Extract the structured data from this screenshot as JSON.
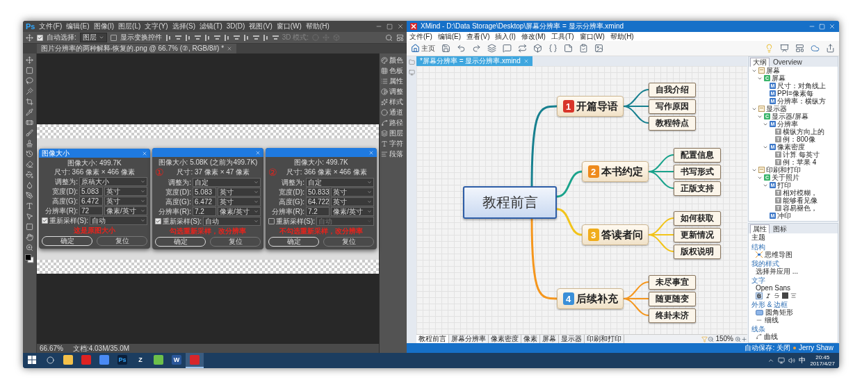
{
  "photoshop": {
    "logo": "Ps",
    "menu": [
      "文件(F)",
      "编辑(E)",
      "图像(I)",
      "图层(L)",
      "文字(Y)",
      "选择(S)",
      "滤镜(T)",
      "3D(D)",
      "视图(V)",
      "窗口(W)",
      "帮助(H)"
    ],
    "options": {
      "auto_select": {
        "label": "自动选择:",
        "checked": true
      },
      "target": "图层",
      "show_transform": {
        "label": "显示变换控件",
        "checked": false
      },
      "mode_3d": "3D 模式:"
    },
    "document_tab": "图片分辨率的两种解释-恢复的.png @ 66.7% (②, RGB/8#) *",
    "dialogs": [
      {
        "title": "图像大小",
        "image_size": "图像大小: 499.7K",
        "dimensions": "尺寸: 366 像素 × 466 像素",
        "fit": {
          "label": "调整为:",
          "value": "原稿大小"
        },
        "rows": [
          {
            "label": "宽度(D):",
            "value": "5.083",
            "unit": "英寸"
          },
          {
            "label": "高度(G):",
            "value": "6.472",
            "unit": "英寸"
          },
          {
            "label": "分辨率(R):",
            "value": "72",
            "unit": "像素/英寸"
          }
        ],
        "resample": {
          "label": "重新采样(S):",
          "checked": true,
          "value": "自动"
        },
        "caption": "这是原图大小",
        "buttons": [
          "确定",
          "复位"
        ]
      },
      {
        "marker": "①",
        "image_size": "图像大小: 5.08K (之前为499.7K)",
        "dimensions": "尺寸: 37 像素 × 47 像素",
        "fit": {
          "label": "调整为:",
          "value": "自定"
        },
        "rows": [
          {
            "label": "宽度(D):",
            "value": "5.083",
            "unit": "英寸"
          },
          {
            "label": "高度(G):",
            "value": "6.472",
            "unit": "英寸"
          },
          {
            "label": "分辨率(R):",
            "value": "7.2",
            "unit": "像素/英寸"
          }
        ],
        "resample": {
          "label": "重新采样(S):",
          "checked": true,
          "value": "自动"
        },
        "caption": "勾选重新采样，改分辨率",
        "buttons": [
          "确定",
          "复位"
        ]
      },
      {
        "marker": "②",
        "image_size": "图像大小: 499.7K",
        "dimensions": "尺寸: 366 像素 × 466 像素",
        "fit": {
          "label": "调整为:",
          "value": "自定"
        },
        "rows": [
          {
            "label": "宽度(D):",
            "value": "50.833",
            "unit": "英寸"
          },
          {
            "label": "高度(G):",
            "value": "64.722",
            "unit": "英寸"
          },
          {
            "label": "分辨率(R):",
            "value": "7.2",
            "unit": "像素/英寸"
          }
        ],
        "resample": {
          "label": "重新采样(S):",
          "checked": false,
          "value": "自动"
        },
        "caption": "不勾选重新采样，改分辨率",
        "buttons": [
          "确定",
          "复位"
        ]
      }
    ],
    "panels": [
      "颜色",
      "色板",
      "属性",
      "调整",
      "样式",
      "通道",
      "路径",
      "图层",
      "字符",
      "段落"
    ],
    "status": {
      "zoom": "66.67%",
      "doc": "文档:4.03M/35.0M"
    }
  },
  "xmind": {
    "title": "XMind - D:\\Data Storage\\Desktop\\屏幕分辨率 = 显示分辨率.xmind",
    "menu": [
      "文件(F)",
      "编辑(E)",
      "查看(V)",
      "插入(I)",
      "修改(M)",
      "工具(T)",
      "窗口(W)",
      "帮助(H)"
    ],
    "home_label": "主页",
    "file_tab": "*屏幕分辨率 = 显示分辨率.xmind",
    "map": {
      "central": "教程前言",
      "topics": [
        {
          "badge": "1",
          "label": "开篇导语",
          "color": "#d8352a",
          "branch": {
            "color": "#17808f"
          },
          "children": [
            "自我介绍",
            "写作原因",
            "教程特点"
          ]
        },
        {
          "badge": "2",
          "label": "本书约定",
          "color": "#ee8a1c",
          "branch": {
            "color": "#1aa38c"
          },
          "children": [
            "配置信息",
            "书写形式",
            "正版支持"
          ]
        },
        {
          "badge": "3",
          "label": "答读者问",
          "color": "#f0ad1c",
          "branch": {
            "color": "#f2c41a"
          },
          "children": [
            "如何获取",
            "更新情况",
            "版权说明"
          ]
        },
        {
          "badge": "4",
          "label": "后续补充",
          "color": "#3a8fd8",
          "branch": {
            "color": "#f5961c"
          },
          "children": [
            "未尽事宜",
            "随更随变",
            "终卦未济"
          ]
        }
      ]
    },
    "sheets": [
      {
        "label": "教程前言",
        "selected": true
      },
      {
        "label": "屏幕分辨率",
        "selected": false
      },
      {
        "label": "像素密度",
        "selected": false
      },
      {
        "label": "像素",
        "selected": false
      },
      {
        "label": "屏幕",
        "selected": false
      },
      {
        "label": "显示器",
        "selected": false
      },
      {
        "label": "印刷和打印",
        "selected": false
      }
    ],
    "zoom": "150%",
    "outline": {
      "tabs": [
        {
          "label": "大纲",
          "selected": true
        },
        {
          "label": "Overview",
          "selected": false
        }
      ],
      "tree": [
        {
          "kind": "sheet",
          "label": "屏幕",
          "expanded": true,
          "children": [
            {
              "kind": "central",
              "icon": "C",
              "label": "屏幕",
              "expanded": true,
              "children": [
                {
                  "kind": "main",
                  "icon": "M",
                  "label": "尺寸：对角线上"
                },
                {
                  "kind": "main",
                  "icon": "M",
                  "label": "PPI=像素每"
                },
                {
                  "kind": "main",
                  "icon": "M",
                  "label": "分辨率：横纵方"
                }
              ]
            }
          ]
        },
        {
          "kind": "sheet",
          "label": "显示器",
          "expanded": true,
          "children": [
            {
              "kind": "central",
              "icon": "C",
              "label": "显示器/屏幕",
              "expanded": true,
              "children": [
                {
                  "kind": "main",
                  "icon": "M",
                  "label": "分辨率",
                  "expanded": true,
                  "children": [
                    {
                      "kind": "sub",
                      "icon": "T",
                      "label": "横纵方向上的"
                    },
                    {
                      "kind": "sub",
                      "icon": "T",
                      "label": "例：800像"
                    }
                  ]
                },
                {
                  "kind": "main",
                  "icon": "M",
                  "label": "像素密度",
                  "expanded": true,
                  "children": [
                    {
                      "kind": "sub",
                      "icon": "T",
                      "label": "计算 每英寸"
                    },
                    {
                      "kind": "sub",
                      "icon": "T",
                      "label": "例：苹果 4"
                    }
                  ]
                }
              ]
            }
          ]
        },
        {
          "kind": "sheet",
          "label": "印刷和打印",
          "expanded": true,
          "children": [
            {
              "kind": "central",
              "icon": "C",
              "label": "关于照片",
              "expanded": true,
              "children": [
                {
                  "kind": "main",
                  "icon": "M",
                  "label": "打印",
                  "expanded": true,
                  "children": [
                    {
                      "kind": "sub",
                      "icon": "T",
                      "label": "相对模糊，"
                    },
                    {
                      "kind": "sub",
                      "icon": "T",
                      "label": "能够看见像"
                    },
                    {
                      "kind": "sub",
                      "icon": "T",
                      "label": "容易褪色，"
                    }
                  ]
                },
                {
                  "kind": "main",
                  "icon": "M",
                  "label": "冲印"
                }
              ]
            }
          ]
        }
      ]
    },
    "properties": {
      "tabs": [
        {
          "label": "属性",
          "selected": true
        },
        {
          "label": "图标",
          "selected": false
        }
      ],
      "heading": "主题",
      "sections": [
        {
          "kind": "structure",
          "title": "结构",
          "value": "思维导图"
        },
        {
          "kind": "style",
          "title": "我的样式",
          "value": "选择并应用 ..."
        },
        {
          "kind": "text",
          "title": "文字",
          "font": "Open Sans",
          "bold": true,
          "italic": false
        },
        {
          "kind": "shape",
          "title": "外形 & 边框",
          "shape": "圆角矩形",
          "border": "细线"
        },
        {
          "kind": "line",
          "title": "线条",
          "value": "曲线"
        }
      ]
    },
    "status": {
      "autosave": "自动保存: 关闭",
      "user": "Jerry Shaw"
    }
  },
  "taskbar": {
    "apps": [
      {
        "kind": "explorer",
        "selected": false
      },
      {
        "kind": "netease",
        "selected": false
      },
      {
        "kind": "chrome",
        "selected": false
      },
      {
        "kind": "photoshop",
        "label": "Ps",
        "selected": false
      },
      {
        "kind": "letter",
        "label": "Z",
        "selected": false
      },
      {
        "kind": "gallery",
        "selected": false
      },
      {
        "kind": "word",
        "label": "W",
        "selected": false
      },
      {
        "kind": "xmind",
        "selected": true
      }
    ],
    "ime": "中",
    "time": "20:45",
    "date": "2017/4/27"
  }
}
